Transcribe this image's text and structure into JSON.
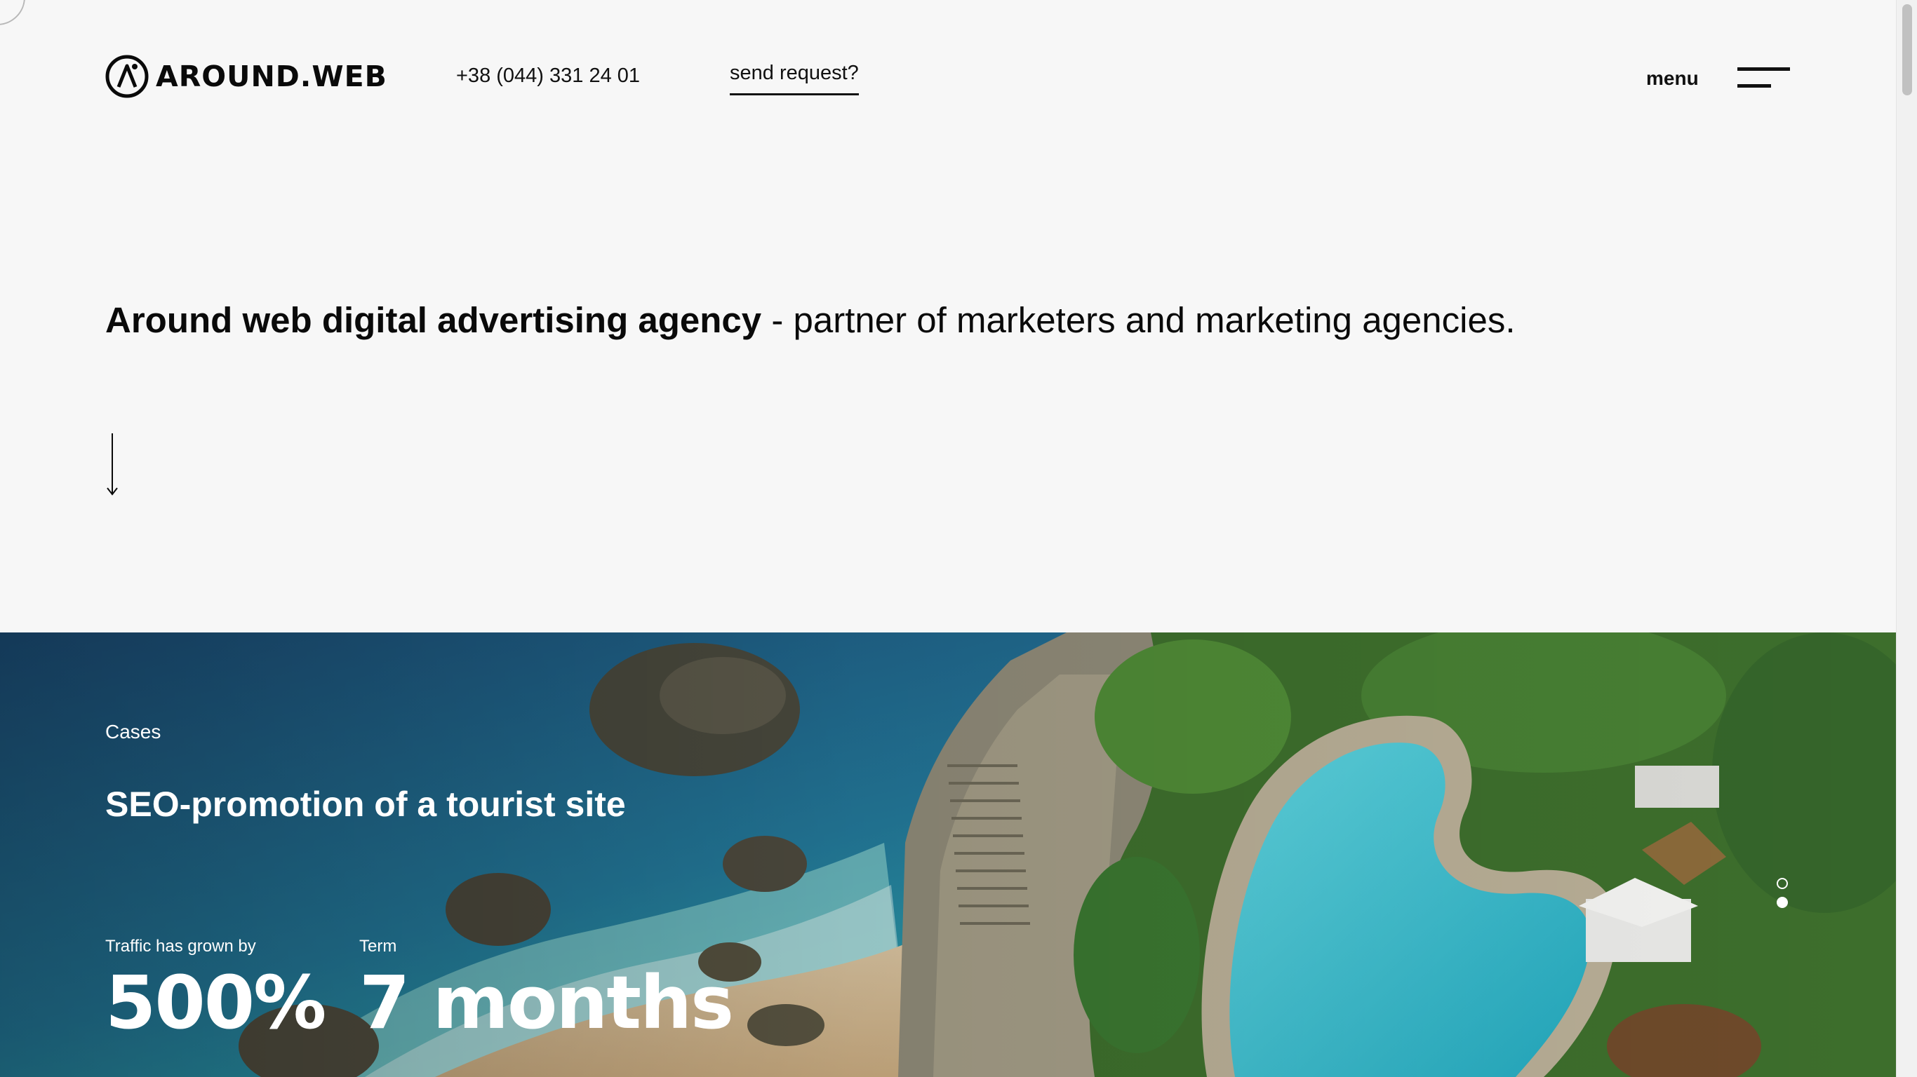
{
  "header": {
    "logo_text": "AROUND.WEB",
    "phone": "+38 (044) 331 24 01",
    "send_request": "send request?",
    "menu_label": "menu"
  },
  "hero": {
    "headline_bold": "Around web digital advertising agency",
    "headline_rest": " - partner of marketers and marketing agencies."
  },
  "case": {
    "section_label": "Cases",
    "title": "SEO-promotion of a tourist site",
    "stats": [
      {
        "label": "Traffic has grown by",
        "value": "500%"
      },
      {
        "label": "Term",
        "value": "7 months"
      }
    ],
    "slider": {
      "total": 2,
      "active_index": 1
    }
  },
  "colors": {
    "background": "#f7f7f7",
    "text": "#0a0a0a",
    "overlay_text": "#ffffff",
    "sea_deep": "#1f5f86",
    "sea_turquoise": "#2eb3b0",
    "pool": "#3ec3d0",
    "greenery": "#3f7a2f"
  },
  "icons": {
    "logo": "around-web-logo-icon",
    "scroll_down": "arrow-down-icon",
    "menu": "hamburger-icon"
  }
}
